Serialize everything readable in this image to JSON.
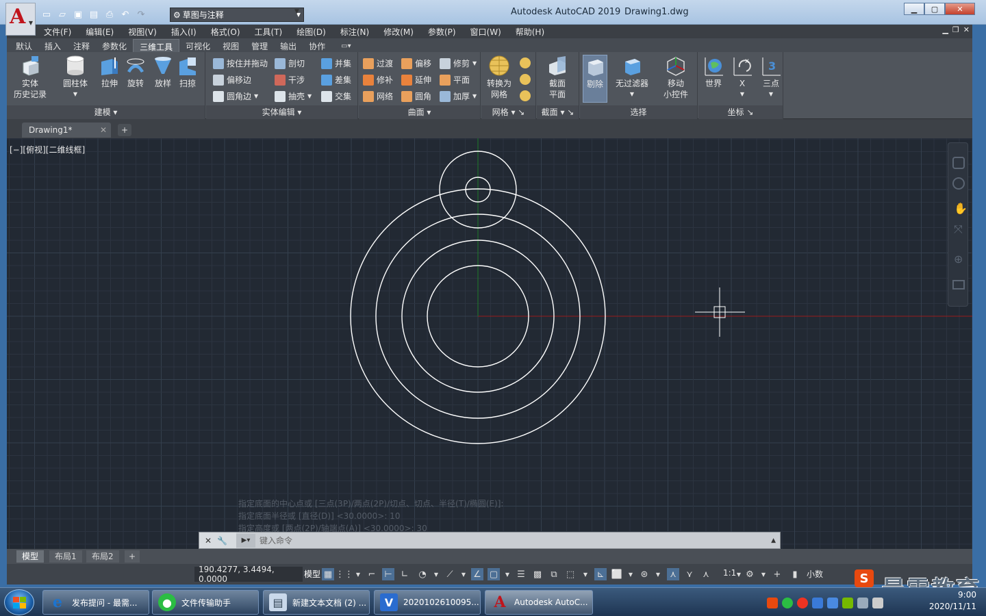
{
  "window": {
    "workspace": "草图与注释",
    "app_title": "Autodesk AutoCAD 2019",
    "doc_title": "Drawing1.dwg"
  },
  "menu": [
    "文件(F)",
    "编辑(E)",
    "视图(V)",
    "插入(I)",
    "格式(O)",
    "工具(T)",
    "绘图(D)",
    "标注(N)",
    "修改(M)",
    "参数(P)",
    "窗口(W)",
    "帮助(H)"
  ],
  "ribbon_tabs": [
    "默认",
    "插入",
    "注释",
    "参数化",
    "三维工具",
    "可视化",
    "视图",
    "管理",
    "输出",
    "协作"
  ],
  "ribbon_active_tab": "三维工具",
  "panels": {
    "modeling": {
      "title": "建模",
      "history": "实体\n历史记录",
      "cylinder": "圆柱体",
      "extrude": "拉伸",
      "revolve": "旋转",
      "loft": "放样",
      "sweep": "扫掠"
    },
    "solid_edit": {
      "title": "实体编辑",
      "presspull": "按住并拖动",
      "offset_edge": "偏移边",
      "fillet_edge": "圆角边",
      "slice": "剖切",
      "interfere": "干涉",
      "shell": "抽壳",
      "union": "并集",
      "subtract": "差集",
      "intersect": "交集"
    },
    "surface": {
      "title": "曲面",
      "blend": "过渡",
      "offset": "偏移",
      "trim": "修剪",
      "patch": "修补",
      "extend": "延伸",
      "planar": "平面",
      "network": "网络",
      "fillet": "圆角",
      "thicken": "加厚"
    },
    "mesh": {
      "title": "网格",
      "convert": "转换为\n网格"
    },
    "section": {
      "title": "截面",
      "plane": "截面\n平面"
    },
    "selection": {
      "title": "选择",
      "cull": "剔除",
      "no_filter": "无过滤器",
      "gizmo": "移动\n小控件"
    },
    "coordinates": {
      "title": "坐标",
      "world": "世界",
      "x": "X",
      "three_point": "三点",
      "three_num": "3"
    }
  },
  "file_tab": {
    "name": "Drawing1*"
  },
  "viewport": {
    "label": "[−][俯视][二维线框]",
    "background": "#222933",
    "grid_color": "#2c3440",
    "major_grid_color": "#34404e",
    "ucs_x_color": "#9b1b1b",
    "ucs_y_color": "#1e7a2a"
  },
  "command": {
    "history": [
      "指定底面的中心点或 [三点(3P)/两点(2P)/切点、切点、半径(T)/椭圆(E)]:",
      "指定底面半径或 [直径(D)] <30.0000>: 10",
      "指定高度或 [两点(2P)/轴端点(A)] <30.0000>: 30"
    ],
    "placeholder": "键入命令"
  },
  "layout_tabs": [
    "模型",
    "布局1",
    "布局2"
  ],
  "status": {
    "coordinates": "190.4277, 3.4494, 0.0000",
    "model": "模型",
    "scale": "1:1",
    "units": "小数"
  },
  "brand": {
    "s": "S",
    "text": "最需教育"
  },
  "taskbar": {
    "items": [
      {
        "label": "发布提问 - 最需...",
        "icon_color": "#1c74d0"
      },
      {
        "label": "文件传输助手",
        "icon_color": "#2bbd43"
      },
      {
        "label": "新建文本文档 (2) ...",
        "icon_color": "#6b8fb5"
      },
      {
        "label": "2020102610095...",
        "icon_color": "#2a6ccf"
      },
      {
        "label": "Autodesk AutoC...",
        "icon_color": "#c0141c"
      }
    ],
    "time": "9:00",
    "date": "2020/11/11"
  }
}
